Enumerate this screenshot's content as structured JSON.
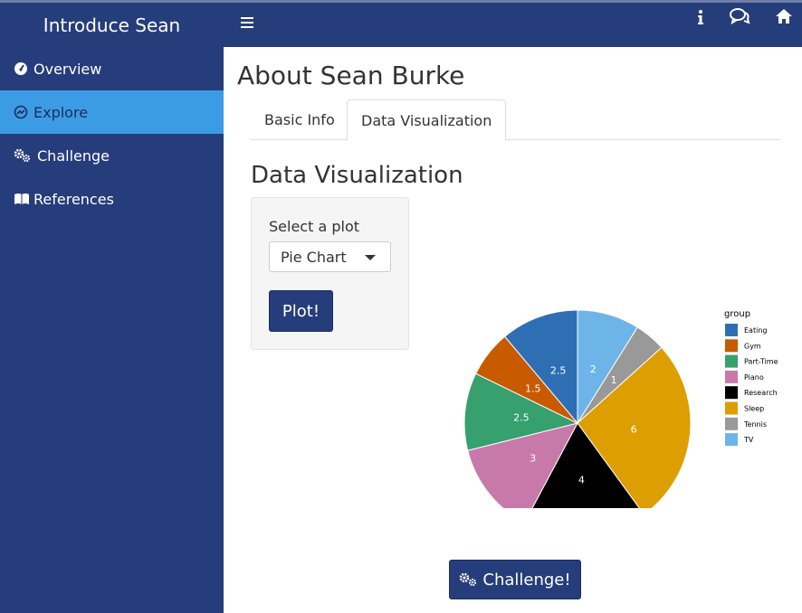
{
  "app": {
    "brand": "Introduce Sean"
  },
  "navbar": {
    "icons": [
      "info-icon",
      "comments-icon",
      "home-icon"
    ]
  },
  "sidebar": {
    "items": [
      {
        "label": "Overview",
        "icon": "tachometer-icon"
      },
      {
        "label": "Explore",
        "icon": "compass-icon",
        "active": true
      },
      {
        "label": "Challenge",
        "icon": "cogs-icon"
      },
      {
        "label": "References",
        "icon": "book-icon"
      }
    ]
  },
  "main": {
    "title": "About Sean Burke",
    "tabs": [
      {
        "label": "Basic Info"
      },
      {
        "label": "Data Visualization",
        "active": true
      }
    ],
    "section_title": "Data Visualization",
    "controls": {
      "select_label": "Select a plot",
      "select_value": "Pie Chart",
      "plot_button": "Plot!"
    },
    "challenge_button": "Challenge!"
  },
  "colors": {
    "navy": "#263d7b",
    "active": "#3c9ce3"
  },
  "chart_data": {
    "type": "pie",
    "legend_title": "group",
    "legend_position": "right",
    "categories": [
      "Eating",
      "Gym",
      "Part-Time",
      "Piano",
      "Research",
      "Sleep",
      "Tennis",
      "TV"
    ],
    "values": [
      2.5,
      1.5,
      2.5,
      3,
      4,
      6,
      1,
      2
    ],
    "colors": [
      "#2e6fb4",
      "#c85a00",
      "#36a06e",
      "#c77aa9",
      "#000000",
      "#dc9e00",
      "#999999",
      "#6db4e8"
    ]
  }
}
